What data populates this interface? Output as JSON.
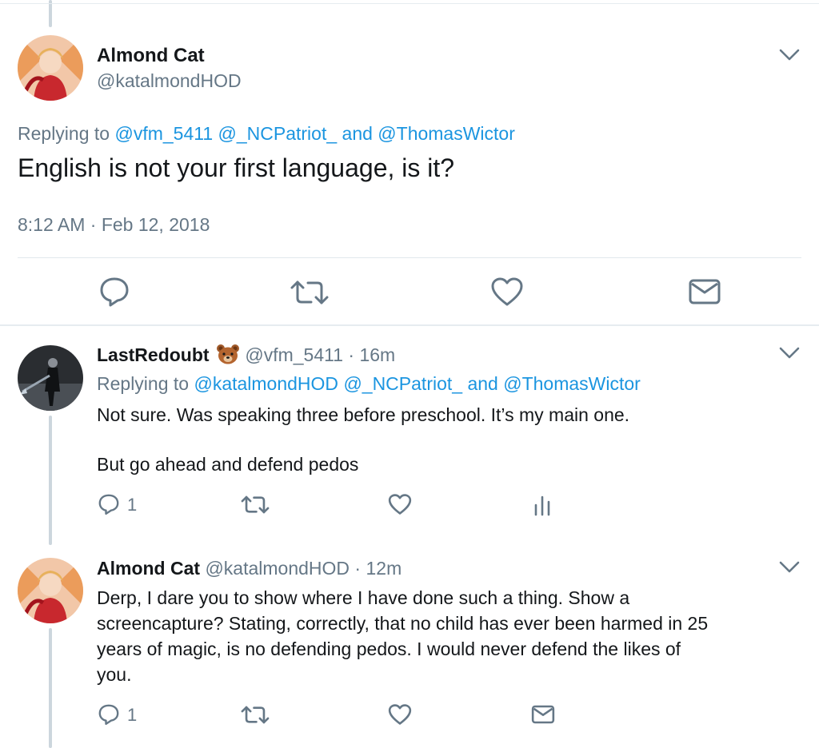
{
  "main_tweet": {
    "name": "Almond Cat",
    "handle": "@katalmondHOD",
    "replying_prefix": "Replying to",
    "replying_users": [
      "@vfm_5411",
      "@_NCPatriot_",
      "@ThomasWictor"
    ],
    "replying_and": "and",
    "text": "English is not your first language, is it?",
    "timestamp": "8:12 AM · Feb 12, 2018",
    "actions": [
      "reply-icon",
      "retweet-icon",
      "like-icon",
      "share-icon"
    ]
  },
  "replies": [
    {
      "name": "LastRedoubt",
      "emoji": "bear-face",
      "handle": "@vfm_5411",
      "separator": "·",
      "time": "16m",
      "replying_prefix": "Replying to",
      "replying_users": [
        "@katalmondHOD",
        "@_NCPatriot_",
        "@ThomasWictor"
      ],
      "replying_and": "and",
      "text_lines": [
        "Not sure. Was speaking three before preschool. It’s my main one.",
        "But go ahead and defend pedos"
      ],
      "reply_count": "1"
    },
    {
      "name": "Almond Cat",
      "handle": "@katalmondHOD",
      "separator": "·",
      "time": "12m",
      "text_lines": [
        "Derp, I dare you to show where I have done such a thing. Show a",
        "screencapture? Stating, correctly, that no child has ever been harmed in 25",
        "years of magic, is no defending pedos. I would never defend the likes of",
        "you."
      ],
      "reply_count": "1"
    }
  ],
  "colors": {
    "link": "#1b95e0",
    "muted": "#657786",
    "icon": "#657786",
    "text": "#14171a",
    "divider": "#e1e8ed",
    "thread_line": "#ccd6dd"
  }
}
